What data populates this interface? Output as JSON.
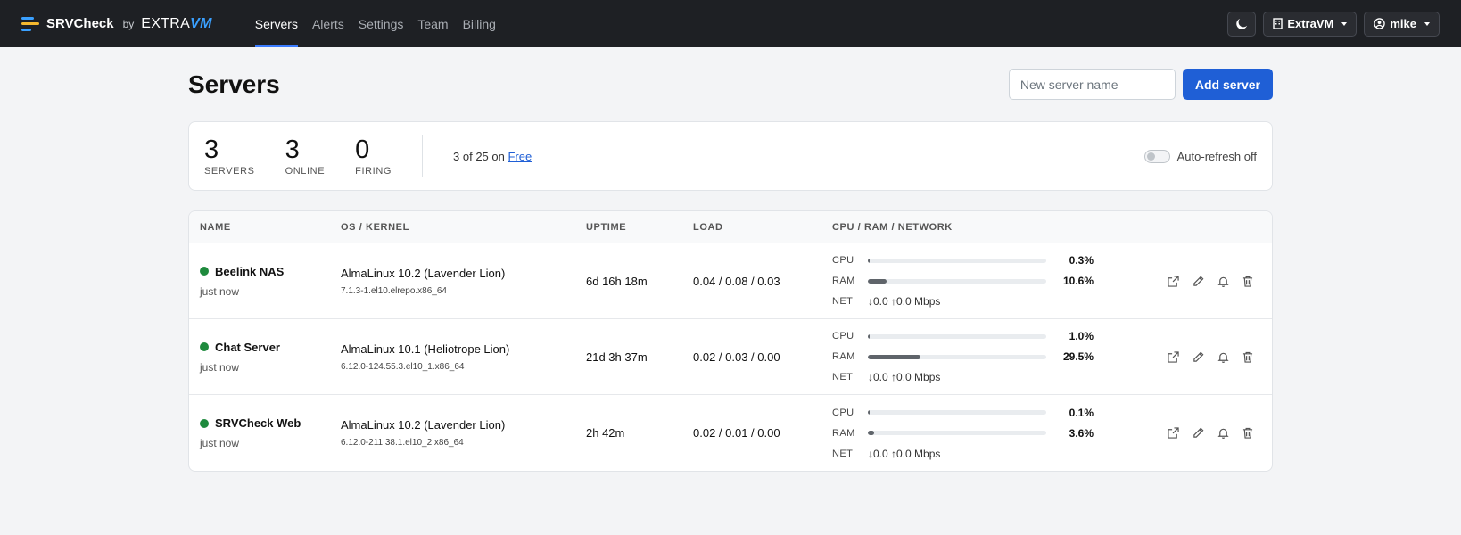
{
  "navbar": {
    "brand": "SRVCheck",
    "by": "by",
    "partner": "EXTRA",
    "partner_suffix": "VM",
    "links": [
      "Servers",
      "Alerts",
      "Settings",
      "Team",
      "Billing"
    ],
    "org_label": "ExtraVM",
    "user_label": "mike"
  },
  "page": {
    "title": "Servers",
    "new_server_placeholder": "New server name",
    "new_server_value": "",
    "add_button": "Add server"
  },
  "stats": {
    "items": [
      {
        "value": "3",
        "label": "SERVERS"
      },
      {
        "value": "3",
        "label": "ONLINE"
      },
      {
        "value": "0",
        "label": "FIRING"
      }
    ],
    "plan_prefix": "3 of 25 on",
    "plan_name": "Free",
    "auto_refresh_label": "Auto-refresh off"
  },
  "table": {
    "headers": [
      "NAME",
      "OS / KERNEL",
      "UPTIME",
      "LOAD",
      "CPU / RAM / NETWORK"
    ],
    "metric_labels": {
      "cpu": "CPU",
      "ram": "RAM",
      "net": "NET"
    },
    "rows": [
      {
        "name": "Beelink NAS",
        "seen": "just now",
        "status_color": "#1e8a3d",
        "os": "AlmaLinux 10.2 (Lavender Lion)",
        "kernel": "7.1.3-1.el10.elrepo.x86_64",
        "uptime": "6d 16h 18m",
        "load": "0.04 / 0.08 / 0.03",
        "cpu": "0.3%",
        "cpu_pct": 0.3,
        "ram": "10.6%",
        "ram_pct": 10.6,
        "net": "↓0.0  ↑0.0 Mbps"
      },
      {
        "name": "Chat Server",
        "seen": "just now",
        "status_color": "#1e8a3d",
        "os": "AlmaLinux 10.1 (Heliotrope Lion)",
        "kernel": "6.12.0-124.55.3.el10_1.x86_64",
        "uptime": "21d 3h 37m",
        "load": "0.02 / 0.03 / 0.00",
        "cpu": "1.0%",
        "cpu_pct": 1.0,
        "ram": "29.5%",
        "ram_pct": 29.5,
        "net": "↓0.0  ↑0.0 Mbps"
      },
      {
        "name": "SRVCheck Web",
        "seen": "just now",
        "status_color": "#1e8a3d",
        "os": "AlmaLinux 10.2 (Lavender Lion)",
        "kernel": "6.12.0-211.38.1.el10_2.x86_64",
        "uptime": "2h 42m",
        "load": "0.02 / 0.01 / 0.00",
        "cpu": "0.1%",
        "cpu_pct": 0.1,
        "ram": "3.6%",
        "ram_pct": 3.6,
        "net": "↓0.0  ↑0.0 Mbps"
      }
    ]
  },
  "icons": {
    "open": "external-link-icon",
    "edit": "pencil-icon",
    "alerts": "bell-icon",
    "delete": "trash-icon",
    "theme": "moon-icon",
    "org": "building-icon",
    "user": "user-circle-icon"
  },
  "colors": {
    "navbar_bg": "#1e2024",
    "primary": "#1f5fd6",
    "online": "#1e8a3d",
    "bar_fill": "#5f646a"
  }
}
